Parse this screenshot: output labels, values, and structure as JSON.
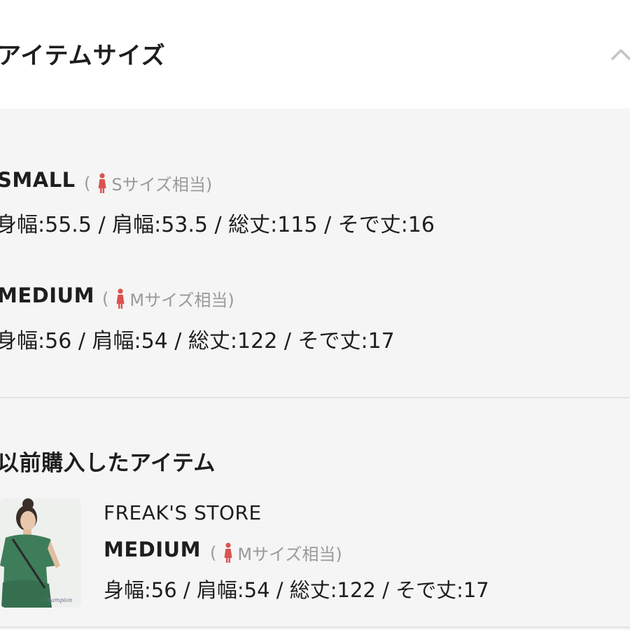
{
  "header": {
    "title": "アイテムサイズ",
    "collapse_icon": "chevron-up-icon"
  },
  "sizes": [
    {
      "name": "SMALL",
      "note_open": "(",
      "note_label": "Sサイズ相当)",
      "icon": "person-figure-icon",
      "measurements": "身幅:55.5 / 肩幅:53.5 / 総丈:115 / そで丈:16"
    },
    {
      "name": "MEDIUM",
      "note_open": "(",
      "note_label": "Mサイズ相当)",
      "icon": "person-figure-icon",
      "measurements": "身幅:56 / 肩幅:54 / 総丈:122 / そで丈:17"
    }
  ],
  "previous": {
    "title": "以前購入したアイテム",
    "brand": "FREAK'S STORE",
    "size_name": "MEDIUM",
    "note_open": "(",
    "note_label": "Mサイズ相当)",
    "measurements": "身幅:56 / 肩幅:54 / 総丈:122 / そで丈:17",
    "thumbnail_icon": "product-photo"
  },
  "colors": {
    "figure_red": "#d9534f",
    "muted_text": "#9a9a9a",
    "body_bg": "#f5f5f5"
  }
}
